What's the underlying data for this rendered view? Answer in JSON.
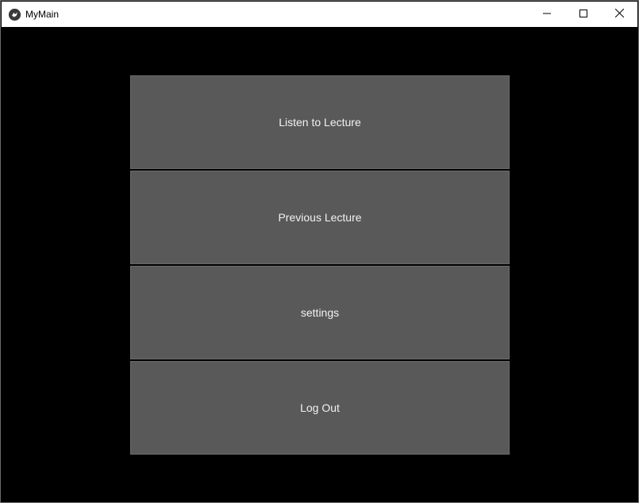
{
  "window": {
    "title": "MyMain",
    "app_icon": "kivy-logo-icon",
    "controls": [
      "minimize-icon",
      "maximize-icon",
      "close-icon"
    ]
  },
  "menu": {
    "buttons": [
      {
        "label": "Listen to Lecture"
      },
      {
        "label": "Previous Lecture"
      },
      {
        "label": "settings"
      },
      {
        "label": "Log Out"
      }
    ]
  },
  "colors": {
    "background": "#000000",
    "button_bg": "#595959",
    "button_text": "#f2f2f2",
    "titlebar_bg": "#ffffff"
  }
}
